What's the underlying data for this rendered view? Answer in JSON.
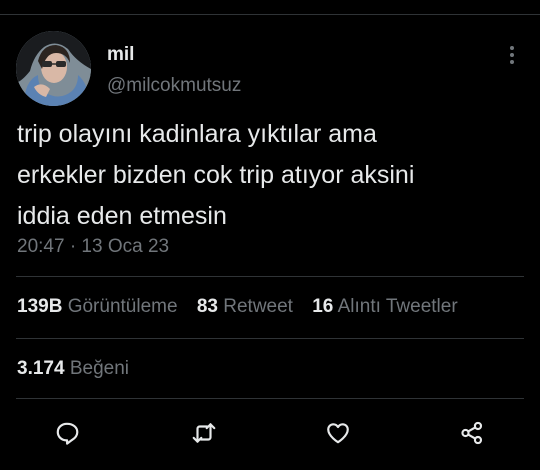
{
  "author": {
    "display_name": "mil",
    "handle": "@milcokmutsuz"
  },
  "tweet": {
    "lines": [
      "trip olayını kadinlara yıktılar ama",
      "erkekler bizden cok trip atıyor aksini",
      "iddia eden etmesin"
    ],
    "timestamp": "20:47 · 13 Oca 23"
  },
  "stats": {
    "views_value": "139B",
    "views_label": "Görüntüleme",
    "retweets_value": "83",
    "retweets_label": "Retweet",
    "quotes_value": "16",
    "quotes_label": "Alıntı Tweetler",
    "likes_value": "3.174",
    "likes_label": "Beğeni"
  },
  "actions": {
    "reply_icon": "reply-icon",
    "retweet_icon": "retweet-icon",
    "like_icon": "heart-icon",
    "share_icon": "share-icon",
    "more_icon": "more-dots-icon"
  },
  "colors": {
    "background": "#000000",
    "text_primary": "#e7e9ea",
    "text_secondary": "#71767b",
    "divider": "#2f3336"
  }
}
